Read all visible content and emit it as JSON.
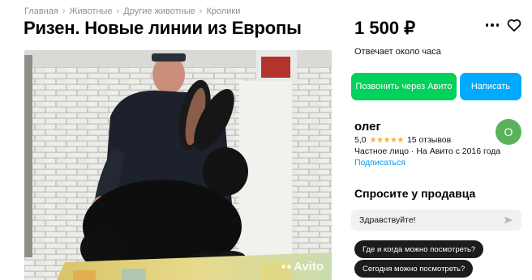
{
  "breadcrumb": [
    "Главная",
    "Животные",
    "Другие животные",
    "Кролики"
  ],
  "breadcrumb_separator": "›",
  "listing": {
    "title": "Ризен. Новые линии из Европы",
    "price": "1 500 ₽",
    "response_time": "Отвечает около часа",
    "watermark": "Avito"
  },
  "actions": {
    "call_label": "Позвонить через Авито",
    "write_label": "Написать",
    "call_color": "#02d15c",
    "write_color": "#00aaff"
  },
  "seller": {
    "name": "олег",
    "rating": "5,0",
    "stars": "★★★★★",
    "reviews": "15 отзывов",
    "type": "Частное лицо · На Авито с 2016 года",
    "subscribe_label": "Подписаться",
    "avatar_letter": "О",
    "avatar_color": "#5ab25c"
  },
  "ask": {
    "heading": "Спросите у продавца",
    "message": "Здравствуйте!",
    "suggestions": [
      "Где и когда можно посмотреть?",
      "Сегодня можно посмотреть?"
    ]
  },
  "icons": [
    "more-icon",
    "heart-icon",
    "send-icon",
    "star-icon"
  ]
}
